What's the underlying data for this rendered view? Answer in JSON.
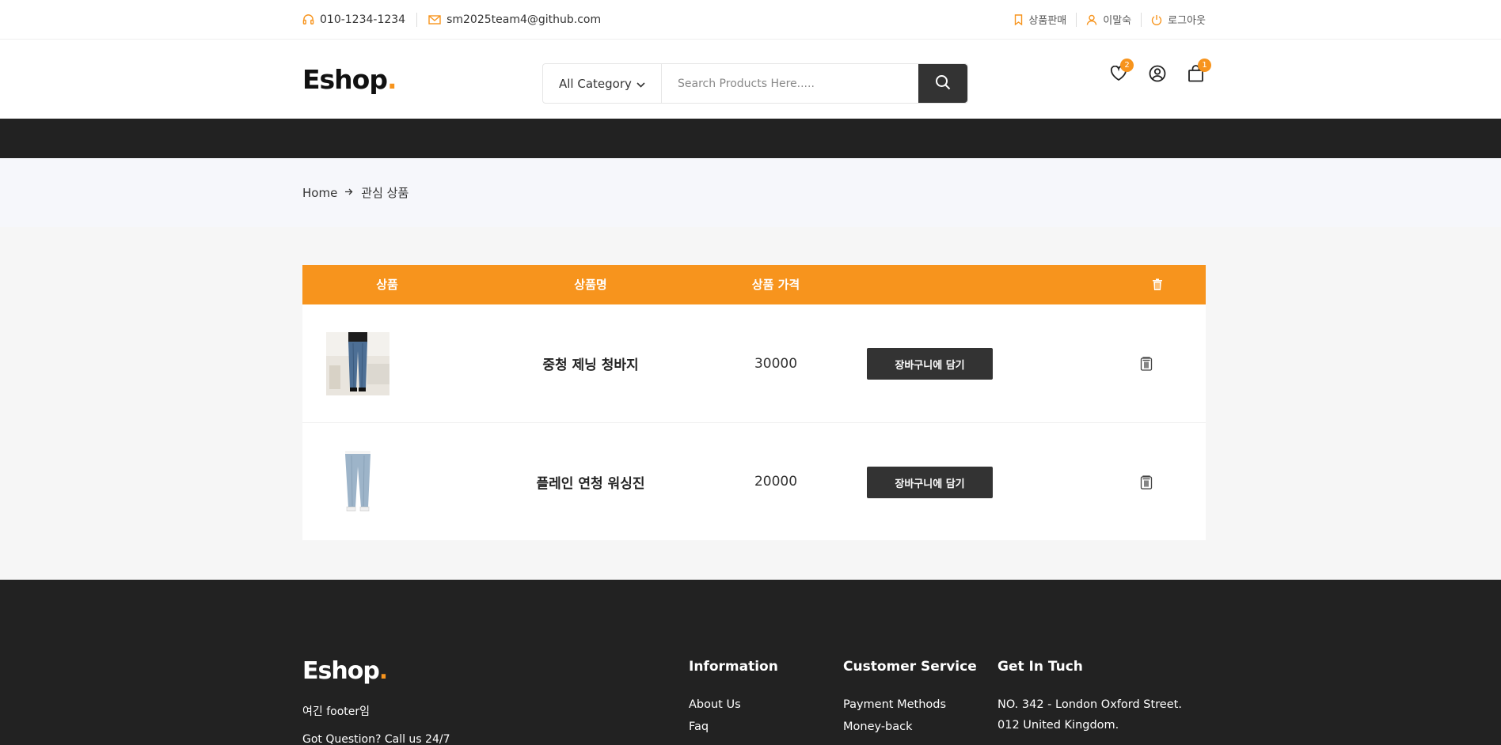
{
  "topbar": {
    "phone": "010-1234-1234",
    "email": "sm2025team4@github.com",
    "links": [
      "상품판매",
      "이말숙",
      "로그아웃"
    ]
  },
  "header": {
    "logo": "Eshop",
    "logo_dot": ".",
    "category": "All Category",
    "search_placeholder": "Search Products Here.....",
    "wishlist_count": "2",
    "cart_count": "1"
  },
  "breadcrumb": {
    "home": "Home",
    "current": "관심 상품"
  },
  "table": {
    "headers": {
      "product": "상품",
      "name": "상품명",
      "price": "상품 가격"
    },
    "rows": [
      {
        "name": "중청 제닝 청바지",
        "price": "30000",
        "button": "장바구니에 담기",
        "image": "dark-jeans-photo"
      },
      {
        "name": "플레인 연청 워싱진",
        "price": "20000",
        "button": "장바구니에 담기",
        "image": "light-jeans-photo"
      }
    ]
  },
  "footer": {
    "logo": "Eshop",
    "logo_dot": ".",
    "text": "여긴 footer임",
    "call": "Got Question? Call us 24/7",
    "information": {
      "title": "Information",
      "links": [
        "About Us",
        "Faq"
      ]
    },
    "customer_service": {
      "title": "Customer Service",
      "links": [
        "Payment Methods",
        "Money-back"
      ]
    },
    "contact": {
      "title": "Get In Tuch",
      "lines": [
        "NO. 342 - London Oxford Street.",
        "012 United Kingdom."
      ]
    }
  },
  "colors": {
    "accent": "#F7941D",
    "dark": "#222222",
    "button": "#333333"
  },
  "icons": [
    "headset-icon",
    "mail-icon",
    "bookmark-icon",
    "user-icon",
    "power-icon",
    "chevron-down-icon",
    "search-icon",
    "heart-icon",
    "account-icon",
    "bag-icon",
    "trash-icon",
    "arrow-right-icon"
  ]
}
